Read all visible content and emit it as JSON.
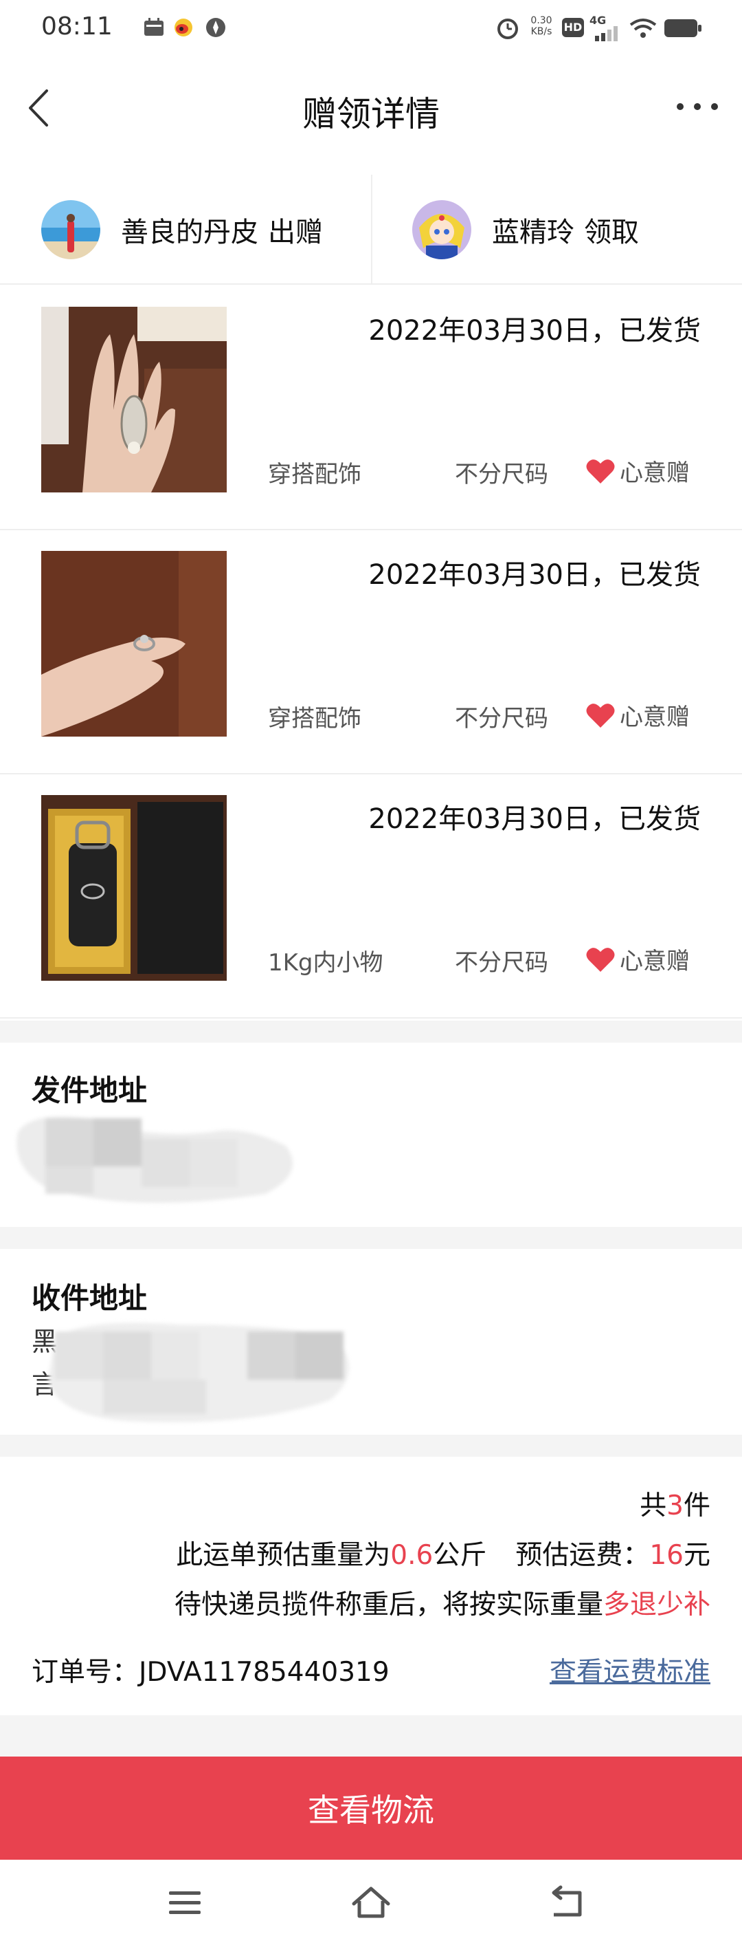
{
  "status_bar": {
    "time": "08:11",
    "network_speed_value": "0.30",
    "network_speed_unit": "KB/s",
    "hd_badge": "HD",
    "network_type": "4G",
    "icons": [
      "calendar-icon",
      "weibo-icon",
      "compass-icon",
      "alarm-icon",
      "signal-icon",
      "wifi-icon",
      "battery-icon"
    ]
  },
  "header": {
    "title": "赠领详情",
    "back_icon": "chevron-left-icon",
    "more_icon": "more-dots-icon"
  },
  "people": {
    "giver": {
      "name": "善良的丹皮",
      "role": "出赠"
    },
    "receiver": {
      "name": "蓝精玲",
      "role": "领取"
    }
  },
  "items": [
    {
      "status": "2022年03月30日，已发货",
      "category": "穿搭配饰",
      "size": "不分尺码",
      "tag": "心意赠"
    },
    {
      "status": "2022年03月30日，已发货",
      "category": "穿搭配饰",
      "size": "不分尺码",
      "tag": "心意赠"
    },
    {
      "status": "2022年03月30日，已发货",
      "category": "1Kg内小物",
      "size": "不分尺码",
      "tag": "心意赠"
    }
  ],
  "sender_address": {
    "title": "发件地址"
  },
  "receiver_address": {
    "title": "收件地址",
    "visible_chars": [
      "黑",
      "言"
    ]
  },
  "summary": {
    "count_prefix": "共",
    "count": "3",
    "count_suffix": "件",
    "weight_prefix": "此运单预估重量为",
    "weight": "0.6",
    "weight_unit": "公斤",
    "fee_label": "预估运费：",
    "fee": "16",
    "fee_unit": "元",
    "note": "待快递员揽件称重后，将按实际重量",
    "note_highlight": "多退少补",
    "order_label": "订单号：",
    "order_number": "JDVA11785440319",
    "fee_standard_link": "查看运费标准"
  },
  "bottom_button": {
    "label": "查看物流"
  },
  "colors": {
    "accent": "#e8424f",
    "link": "#4a6a9c",
    "section_gap": "#f4f4f4"
  }
}
